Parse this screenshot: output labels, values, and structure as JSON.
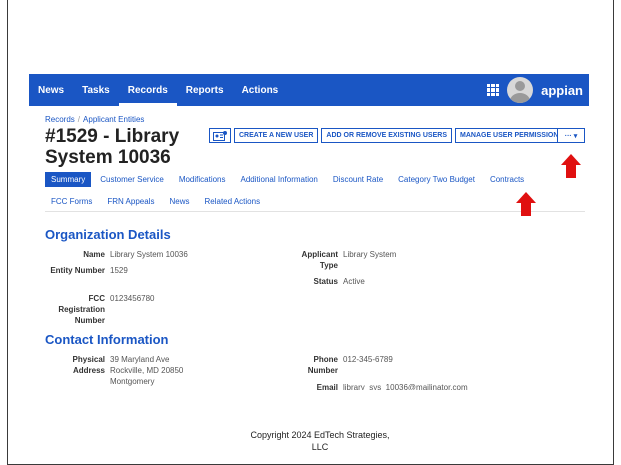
{
  "nav": {
    "items": [
      {
        "label": "News"
      },
      {
        "label": "Tasks"
      },
      {
        "label": "Records",
        "active": true
      },
      {
        "label": "Reports"
      },
      {
        "label": "Actions"
      }
    ],
    "brand": "appian"
  },
  "breadcrumb": {
    "root": "Records",
    "current": "Applicant Entities"
  },
  "record": {
    "title": "#1529 - Library System 10036"
  },
  "actions": {
    "create_user": "CREATE A NEW USER",
    "add_remove_users": "ADD OR REMOVE EXISTING USERS",
    "manage_permissions": "MANAGE USER PERMISSIONS",
    "more": "··· ▾"
  },
  "tabs": {
    "row1": [
      "Summary",
      "Customer Service",
      "Modifications",
      "Additional Information",
      "Discount Rate",
      "Category Two Budget",
      "Contracts"
    ],
    "row2": [
      "FCC Forms",
      "FRN Appeals",
      "News",
      "Related Actions"
    ]
  },
  "org": {
    "heading": "Organization Details",
    "name_label": "Name",
    "name_value": "Library System 10036",
    "entity_label": "Entity Number",
    "entity_value": "1529",
    "fcc_label": "FCC Registration Number",
    "fcc_value": "0123456780",
    "type_label": "Applicant Type",
    "type_value": "Library System",
    "status_label": "Status",
    "status_value": "Active"
  },
  "contact": {
    "heading": "Contact Information",
    "address_label": "Physical Address",
    "address_lines": [
      "39 Maryland Ave",
      "Rockville, MD 20850",
      "Montgomery"
    ],
    "phone_label": "Phone Number",
    "phone_value": "012-345-6789",
    "email_label": "Email",
    "email_value": "library_sys_10036@mailinator.com"
  },
  "footer": {
    "line1": "Copyright 2024 EdTech Strategies,",
    "line2": "LLC"
  },
  "colors": {
    "accent": "#1a56c4",
    "arrow": "#e01010"
  }
}
